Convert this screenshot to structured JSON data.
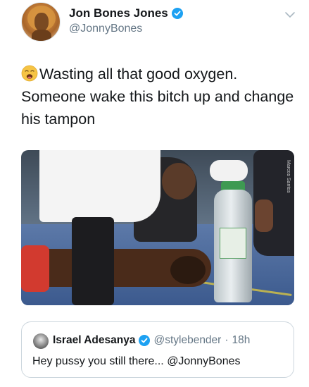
{
  "author": {
    "name": "Jon Bones Jones",
    "handle": "@JonnyBones",
    "verified": true,
    "avatar_icon": "avatar-lion-icon"
  },
  "tweet": {
    "emoji": "weary-face-emoji",
    "text": "Wasting all that good oxygen. Someone wake this bitch up and change his tampon"
  },
  "media": {
    "description_icon": "photo",
    "watermark": "Marcos Santos"
  },
  "quoted_tweet": {
    "name": "Israel Adesanya",
    "handle": "@stylebender",
    "separator": "·",
    "time": "18h",
    "verified": true,
    "text": "Hey pussy you still there... @JonnyBones"
  },
  "colors": {
    "verified_blue": "#1da1f2",
    "text_primary": "#14171a",
    "text_secondary": "#657786",
    "border": "#ccd6dd"
  }
}
